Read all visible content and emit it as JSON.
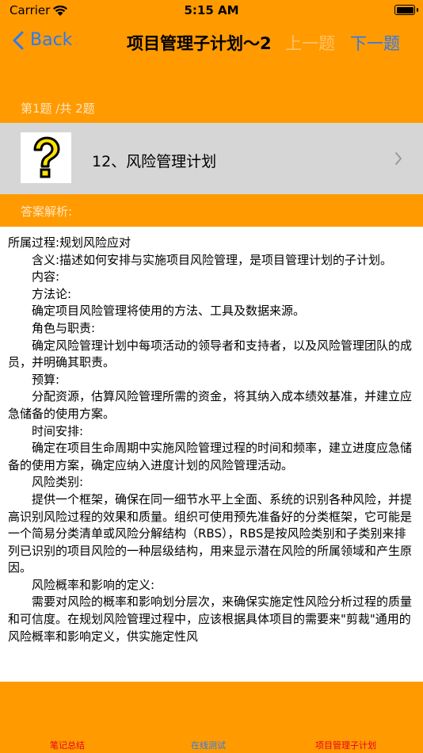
{
  "status": {
    "carrier": "Carrier",
    "time": "5:15 AM"
  },
  "nav": {
    "back_label": "Back",
    "title": "项目管理子计划～2",
    "prev_label": "上一题",
    "next_label": "下一题"
  },
  "question": {
    "counter": "第1题 /共 2题",
    "title": "12、风险管理计划",
    "icon_char": "?"
  },
  "analysis": {
    "label": "答案解析:",
    "lines": [
      "所属过程:规划风险应对",
      "含义:描述如何安排与实施项目风险管理，是项目管理计划的子计划。",
      "内容:",
      "方法论:",
      "确定项目风险管理将使用的方法、工具及数据来源。",
      "角色与职责:",
      "确定风险管理计划中每项活动的领导者和支持者，以及风险管理团队的成员，并明确其职责。",
      "预算:",
      "分配资源，估算风险管理所需的资金，将其纳入成本绩效基准，并建立应急储备的使用方案。",
      "时间安排:",
      "确定在项目生命周期中实施风险管理过程的时间和频率，建立进度应急储备的使用方案，确定应纳入进度计划的风险管理活动。",
      "风险类别:",
      "提供一个框架，确保在同一细节水平上全面、系统的识别各种风险，并提高识别风险过程的效果和质量。组织可使用预先准备好的分类框架，它可能是一个简易分类清单或风险分解结构（RBS），RBS是按风险类别和子类别来排列已识别的项目风险的一种层级结构，用来显示潜在风险的所属领域和产生原因。",
      "风险概率和影响的定义:",
      "需要对风险的概率和影响划分层次，来确保实施定性风险分析过程的质量和可信度。在规划风险管理过程中，应该根据具体项目的需要来\"剪裁\"通用的风险概率和影响定义，供实施定性风"
    ]
  },
  "tabs": [
    {
      "label": "笔记总结"
    },
    {
      "label": "在线测试"
    },
    {
      "label": "项目管理子计划"
    }
  ],
  "colors": {
    "background": "#ff9a00",
    "accent": "#2a7bf4",
    "tab_inactive": "#e8001c"
  }
}
